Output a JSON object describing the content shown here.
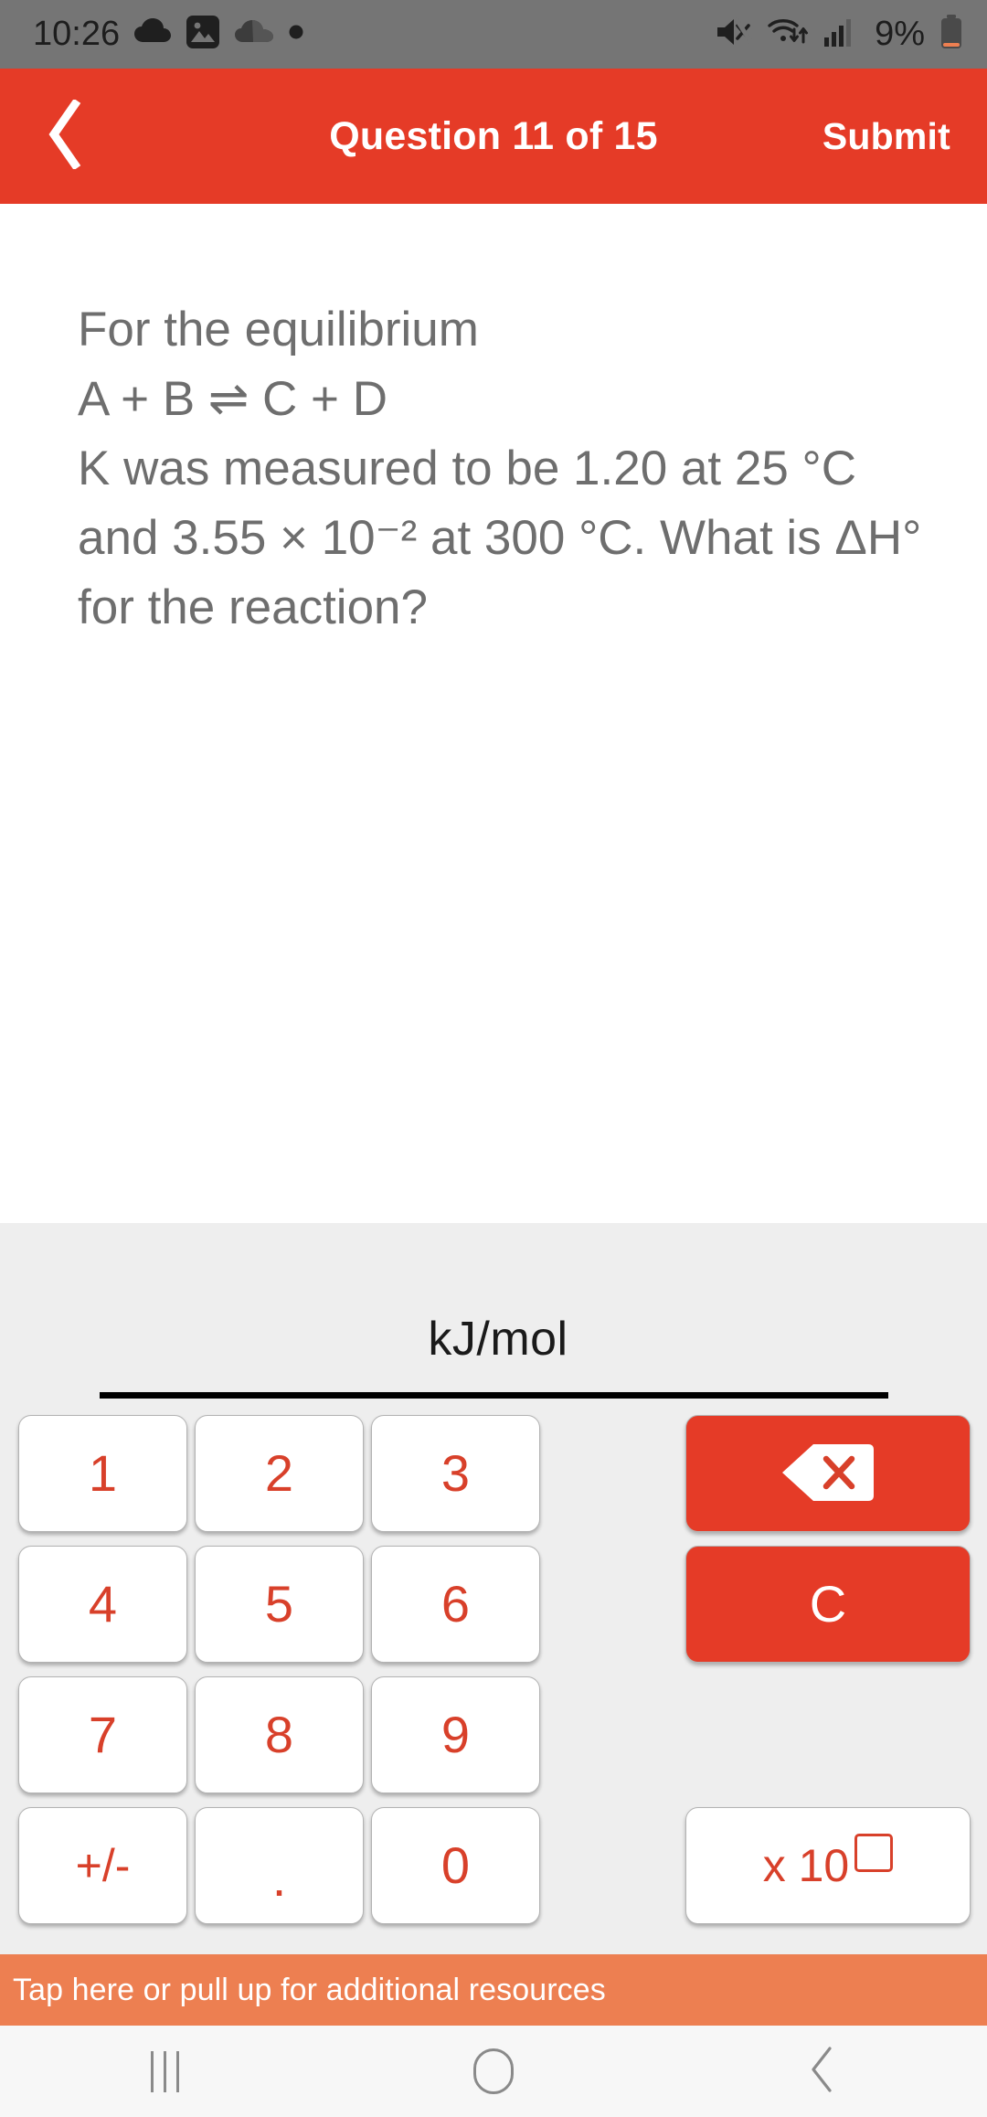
{
  "status_bar": {
    "time": "10:26",
    "battery_percent": "9%",
    "left_icons": [
      "cloud-icon",
      "image-icon",
      "onedrive-icon",
      "dot-icon"
    ],
    "right_icons": [
      "mute-icon",
      "wifi-icon",
      "signal-icon",
      "battery-icon"
    ],
    "background": "#757575"
  },
  "header": {
    "title": "Question 11 of 15",
    "back_icon": "chevron-left-icon",
    "submit_label": "Submit",
    "background": "#e53b27"
  },
  "question": {
    "text": "For the equilibrium\nA + B  ⇌  C + D\nK was measured to be 1.20 at 25 °C and 3.55 × 10⁻² at 300 °C. What is ΔH° for the reaction?",
    "color": "#6e6e6e"
  },
  "answer": {
    "value": "",
    "unit": "kJ/mol"
  },
  "keypad": {
    "keys": [
      {
        "label": "1",
        "name": "key-1",
        "type": "num"
      },
      {
        "label": "2",
        "name": "key-2",
        "type": "num"
      },
      {
        "label": "3",
        "name": "key-3",
        "type": "num"
      },
      {
        "label": "4",
        "name": "key-4",
        "type": "num"
      },
      {
        "label": "5",
        "name": "key-5",
        "type": "num"
      },
      {
        "label": "6",
        "name": "key-6",
        "type": "num"
      },
      {
        "label": "7",
        "name": "key-7",
        "type": "num"
      },
      {
        "label": "8",
        "name": "key-8",
        "type": "num"
      },
      {
        "label": "9",
        "name": "key-9",
        "type": "num"
      },
      {
        "label": "+/-",
        "name": "key-plus-minus",
        "type": "pm"
      },
      {
        "label": ".",
        "name": "key-decimal",
        "type": "dot"
      },
      {
        "label": "0",
        "name": "key-0",
        "type": "num"
      }
    ],
    "backspace": {
      "icon": "backspace-icon"
    },
    "clear": {
      "label": "C"
    },
    "exponent": {
      "label": "x 10",
      "box": "exponent-placeholder-box"
    },
    "accent_color": "#d8402a",
    "red_button_color": "#e53b27",
    "panel_background": "#eeeeee"
  },
  "resources": {
    "text": "Tap here or pull up for additional resources",
    "background": "#ed7f51"
  },
  "nav_bar": {
    "recent_icon": "recent-apps-icon",
    "home_icon": "home-icon",
    "back_icon": "back-icon"
  }
}
